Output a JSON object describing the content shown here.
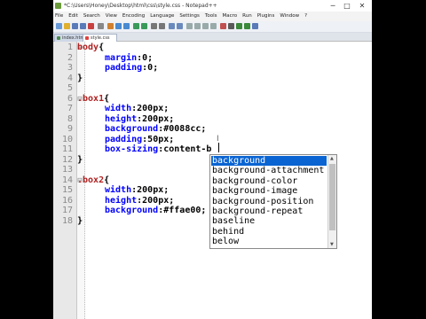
{
  "window": {
    "title": "*C:\\Users\\Honey\\Desktop\\html\\css\\style.css - Notepad++",
    "min": "─",
    "max": "□",
    "close": "✕"
  },
  "menu": [
    "File",
    "Edit",
    "Search",
    "View",
    "Encoding",
    "Language",
    "Settings",
    "Tools",
    "Macro",
    "Run",
    "Plugins",
    "Window",
    "?"
  ],
  "tabs": [
    {
      "label": "index.html",
      "active": false
    },
    {
      "label": "style.css",
      "active": true
    }
  ],
  "code": {
    "line_numbers": [
      "1",
      "2",
      "3",
      "4",
      "5",
      "6",
      "7",
      "8",
      "9",
      "10",
      "11",
      "12",
      "13",
      "14",
      "15",
      "16",
      "17"
    ],
    "lines": [
      {
        "sel": "body",
        "text": "{"
      },
      {
        "prop": "margin",
        "val": ":0;"
      },
      {
        "prop": "padding",
        "val": ":0;"
      },
      {
        "brace": "}"
      },
      {
        "blank": ""
      },
      {
        "sel": ".box1",
        "text": "{"
      },
      {
        "prop": "width",
        "val": ":200px;"
      },
      {
        "prop": "height",
        "val": ":200px;"
      },
      {
        "prop": "background",
        "val": ":#0088cc;"
      },
      {
        "prop": "padding",
        "val": ":50px;"
      },
      {
        "prop": "box-sizing",
        "val": ":content-b"
      },
      {
        "brace": "}"
      },
      {
        "blank": ""
      },
      {
        "sel": ".box2",
        "text": "{"
      },
      {
        "prop": "width",
        "val": ":200px;"
      },
      {
        "prop": "height",
        "val": ":200px;"
      },
      {
        "prop": "background",
        "val": ":#ffae00;"
      },
      {
        "brace": "}"
      }
    ]
  },
  "autocomplete": {
    "items": [
      "background",
      "background-attachment",
      "background-color",
      "background-image",
      "background-position",
      "background-repeat",
      "baseline",
      "behind",
      "below"
    ],
    "selected": "background"
  }
}
